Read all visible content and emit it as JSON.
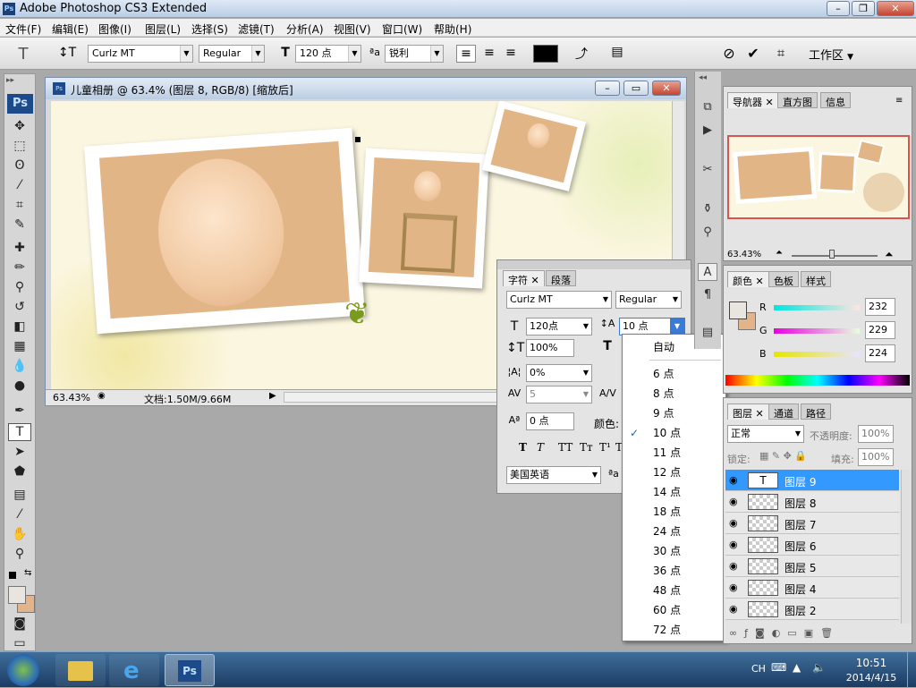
{
  "window": {
    "title": "Adobe Photoshop CS3 Extended",
    "ps_badge": "Ps"
  },
  "menu": [
    "文件(F)",
    "编辑(E)",
    "图像(I)",
    "图层(L)",
    "选择(S)",
    "滤镜(T)",
    "分析(A)",
    "视图(V)",
    "窗口(W)",
    "帮助(H)"
  ],
  "options": {
    "font_family": "Curlz MT",
    "font_style": "Regular",
    "font_size": "120 点",
    "antialias_label": "ªa",
    "antialias": "锐利",
    "color_swatch": "#000000",
    "workspace": "工作区"
  },
  "toolbox": {
    "logo": "Ps"
  },
  "document": {
    "title": "儿童相册 @ 63.4% (图层 8, RGB/8) [缩放后]",
    "zoom": "63.43%",
    "doc_info": "文档:1.50M/9.66M"
  },
  "character_panel": {
    "tabs": [
      "字符",
      "段落"
    ],
    "font_family": "Curlz MT",
    "font_style": "Regular",
    "font_size": "120点",
    "leading": "10 点",
    "vertical_scale": "100%",
    "tracking": "0%",
    "kerning": "5",
    "baseline_shift": "0 点",
    "color_label": "颜色:",
    "language": "美国英语",
    "antialias_label": "ªa",
    "style_buttons": [
      "T",
      "T",
      "TT",
      "Tт",
      "T¹",
      "T"
    ]
  },
  "leading_menu": {
    "items": [
      "自动",
      "6 点",
      "8 点",
      "9 点",
      "10 点",
      "11 点",
      "12 点",
      "14 点",
      "18 点",
      "24 点",
      "30 点",
      "36 点",
      "48 点",
      "60 点",
      "72 点"
    ],
    "selected": "10 点",
    "check": "✓"
  },
  "navigator_panel": {
    "tabs": [
      "导航器",
      "直方图",
      "信息"
    ],
    "zoom": "63.43%"
  },
  "color_panel": {
    "tabs": [
      "颜色",
      "色板",
      "样式"
    ],
    "channels": [
      {
        "label": "R",
        "value": "232"
      },
      {
        "label": "G",
        "value": "229"
      },
      {
        "label": "B",
        "value": "224"
      }
    ],
    "fg_color": "#e8e5e0",
    "bg_color": "#e3b48a"
  },
  "layers_panel": {
    "tabs": [
      "图层",
      "通道",
      "路径"
    ],
    "blend_mode": "正常",
    "opacity_label": "不透明度:",
    "opacity": "100%",
    "lock_label": "锁定:",
    "fill_label": "填充:",
    "fill": "100%",
    "layers": [
      {
        "name": "图层 9",
        "type": "text",
        "selected": true
      },
      {
        "name": "图层 8",
        "type": "image",
        "selected": false
      },
      {
        "name": "图层 7",
        "type": "image",
        "selected": false
      },
      {
        "name": "图层 6",
        "type": "image",
        "selected": false
      },
      {
        "name": "图层 5",
        "type": "image",
        "selected": false
      },
      {
        "name": "图层 4",
        "type": "image",
        "selected": false
      },
      {
        "name": "图层 2",
        "type": "image",
        "selected": false
      }
    ],
    "text_thumb": "T"
  },
  "taskbar": {
    "tray_lang": "CH",
    "time": "10:51",
    "date": "2014/4/15",
    "ps_label": "Ps"
  }
}
